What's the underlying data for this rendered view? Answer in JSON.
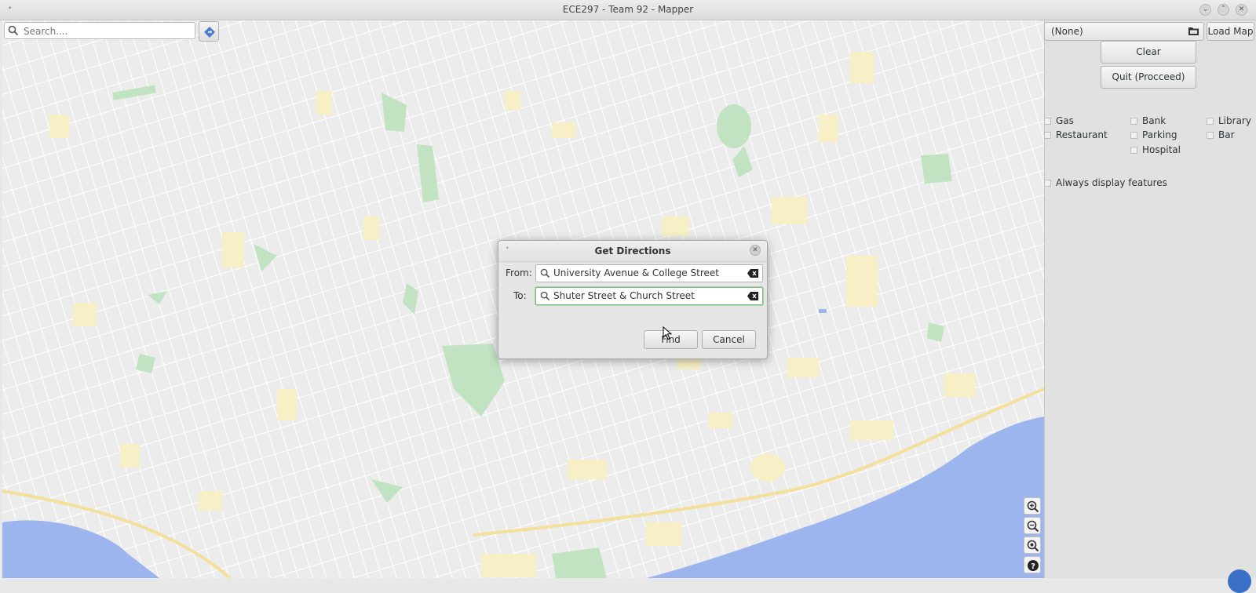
{
  "window": {
    "title": "ECE297 - Team 92 - Mapper"
  },
  "search": {
    "placeholder": "Search...."
  },
  "panel": {
    "map_select_value": "(None)",
    "load_map_label": "Load Map",
    "clear_label": "Clear",
    "quit_label": "Quit (Procceed)",
    "features": [
      "Gas",
      "Restaurant",
      "Bank",
      "Parking",
      "Hospital",
      "Library",
      "Bar"
    ],
    "always_display_label": "Always display features"
  },
  "dialog": {
    "title": "Get Directions",
    "from_label": "From:",
    "from_value": "University Avenue & College Street",
    "to_label": "To:",
    "to_value": "Shuter Street & Church Street",
    "find_label": "Find",
    "cancel_label": "Cancel"
  },
  "colors": {
    "water": "#9db5ee",
    "park": "#c2e3c2",
    "building": "#f7f0c6",
    "road": "#ffffff",
    "highway": "#f4df9b"
  },
  "icons": [
    "search-icon",
    "directions-icon",
    "folder-icon",
    "zoom-in-icon",
    "zoom-out-icon",
    "zoom-fit-icon",
    "help-icon",
    "clear-icon",
    "close-icon"
  ]
}
